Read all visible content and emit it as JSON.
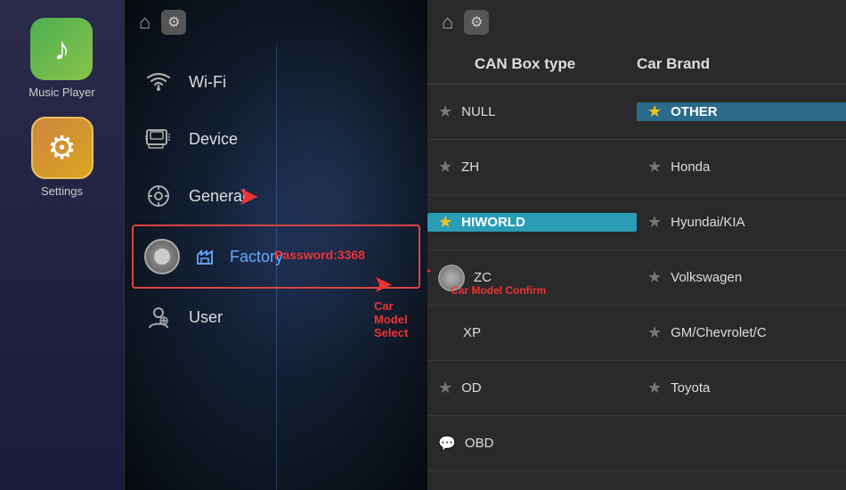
{
  "sidebar": {
    "apps": [
      {
        "id": "music-player",
        "label": "Music Player",
        "icon_type": "music"
      },
      {
        "id": "settings",
        "label": "Settings",
        "icon_type": "settings",
        "active": true
      }
    ]
  },
  "middle_panel": {
    "top_bar": {
      "home_icon": "⌂",
      "gear_icon": "⚙"
    },
    "menu_items": [
      {
        "id": "wifi",
        "label": "Wi-Fi",
        "icon": "📶"
      },
      {
        "id": "device",
        "label": "Device",
        "icon": "🖥"
      },
      {
        "id": "general",
        "label": "General",
        "icon": "⚙"
      },
      {
        "id": "factory",
        "label": "Factory",
        "icon": "🔧",
        "active": true
      },
      {
        "id": "user",
        "label": "User",
        "icon": "👤"
      }
    ],
    "annotations": {
      "password_label": "Password:3368",
      "car_model_select": "Car Model Select",
      "car_model_confirm": "Car Model Confirm"
    }
  },
  "right_panel": {
    "top_bar": {
      "home_icon": "⌂",
      "gear_icon": "⚙"
    },
    "can_box_header": "CAN Box type",
    "car_brand_header": "Car Brand",
    "rows": [
      {
        "left": {
          "label": "NULL",
          "star": "★",
          "star_gold": false
        },
        "right": {
          "label": "OTHER",
          "star": "★",
          "star_gold": true,
          "highlighted": true
        }
      },
      {
        "left": {
          "label": "ZH",
          "star": "★",
          "star_gold": false
        },
        "right": {
          "label": "Honda",
          "star": "★",
          "star_gold": false
        }
      },
      {
        "left": {
          "label": "HIWORLD",
          "star": "★",
          "star_gold": true,
          "highlighted": true
        },
        "right": {
          "label": "Hyundai/KIA",
          "star": "★",
          "star_gold": false
        }
      },
      {
        "left": {
          "label": "ZC",
          "star": "",
          "star_gold": false,
          "toggle": true
        },
        "right": {
          "label": "Volkswagen",
          "star": "★",
          "star_gold": false
        }
      },
      {
        "left": {
          "label": "XP",
          "star": "",
          "star_gold": false
        },
        "right": {
          "label": "GM/Chevrolet/C",
          "star": "★",
          "star_gold": false
        }
      },
      {
        "left": {
          "label": "OD",
          "star": "★",
          "star_gold": false
        },
        "right": {
          "label": "Toyota",
          "star": "★",
          "star_gold": false
        }
      },
      {
        "left": {
          "label": "OBD",
          "star": "",
          "star_gold": false,
          "chat_icon": true
        },
        "right": {
          "label": "",
          "star": "",
          "star_gold": false
        }
      }
    ]
  }
}
